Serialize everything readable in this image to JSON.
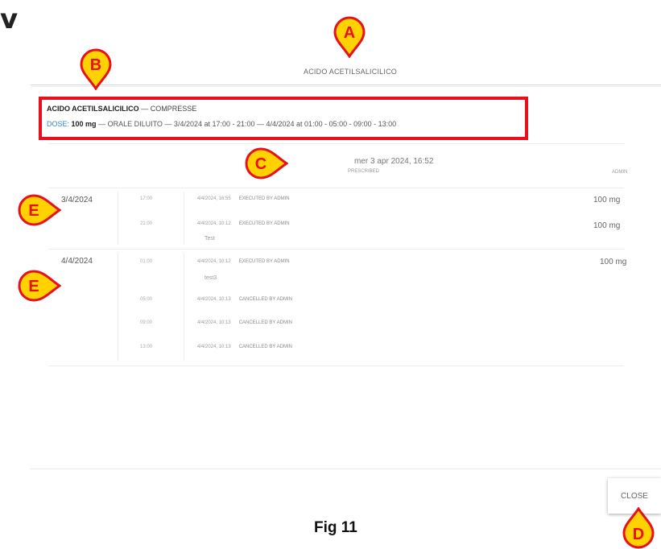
{
  "corner_text": "v",
  "dialog": {
    "title": "ACIDO ACETILSALICILICO",
    "summary": {
      "drug": "ACIDO ACETILSALICILICO",
      "form": "— COMPRESSE",
      "dose_label": "DOSE:",
      "dose_value": "100 mg",
      "schedule": "— ORALE DILUITO — 3/4/2024 at 17:00 - 21:00 — 4/4/2024 at 01:00 - 05:00 - 09:00 - 13:00"
    },
    "timestamp": "mer 3 apr 2024, 16:52",
    "columns": {
      "prescribed": "PRESCRIBED",
      "admin": "ADMIN"
    },
    "days": [
      {
        "date": "3/4/2024",
        "entries": [
          {
            "time": "17:00",
            "event_time": "4/4/2024, 16:55",
            "status": "EXECUTED BY ADMIN",
            "dose": "100 mg",
            "note": ""
          },
          {
            "time": "21:00",
            "event_time": "4/4/2024, 10:12",
            "status": "EXECUTED BY ADMIN",
            "dose": "100 mg",
            "note": "Test"
          }
        ]
      },
      {
        "date": "4/4/2024",
        "entries": [
          {
            "time": "01:00",
            "event_time": "4/4/2024, 10:12",
            "status": "EXECUTED BY ADMIN",
            "dose": "100 mg",
            "note": "test3"
          },
          {
            "time": "05:00",
            "event_time": "4/4/2024, 10:13",
            "status": "CANCELLED BY ADMIN",
            "dose": "",
            "note": ""
          },
          {
            "time": "09:00",
            "event_time": "4/4/2024, 10:13",
            "status": "CANCELLED BY ADMIN",
            "dose": "",
            "note": ""
          },
          {
            "time": "13:00",
            "event_time": "4/4/2024, 10:13",
            "status": "CANCELLED BY ADMIN",
            "dose": "",
            "note": ""
          }
        ]
      }
    ],
    "close_label": "CLOSE"
  },
  "callouts": {
    "a": "A",
    "b": "B",
    "c": "C",
    "d": "D",
    "e1": "E",
    "e2": "E"
  },
  "figure_caption": "Fig 11",
  "colors": {
    "callout_fill": "#ffd200",
    "callout_outline": "#e8101a",
    "highlight_box": "#e8101a",
    "dose_label": "#2f88c8"
  }
}
